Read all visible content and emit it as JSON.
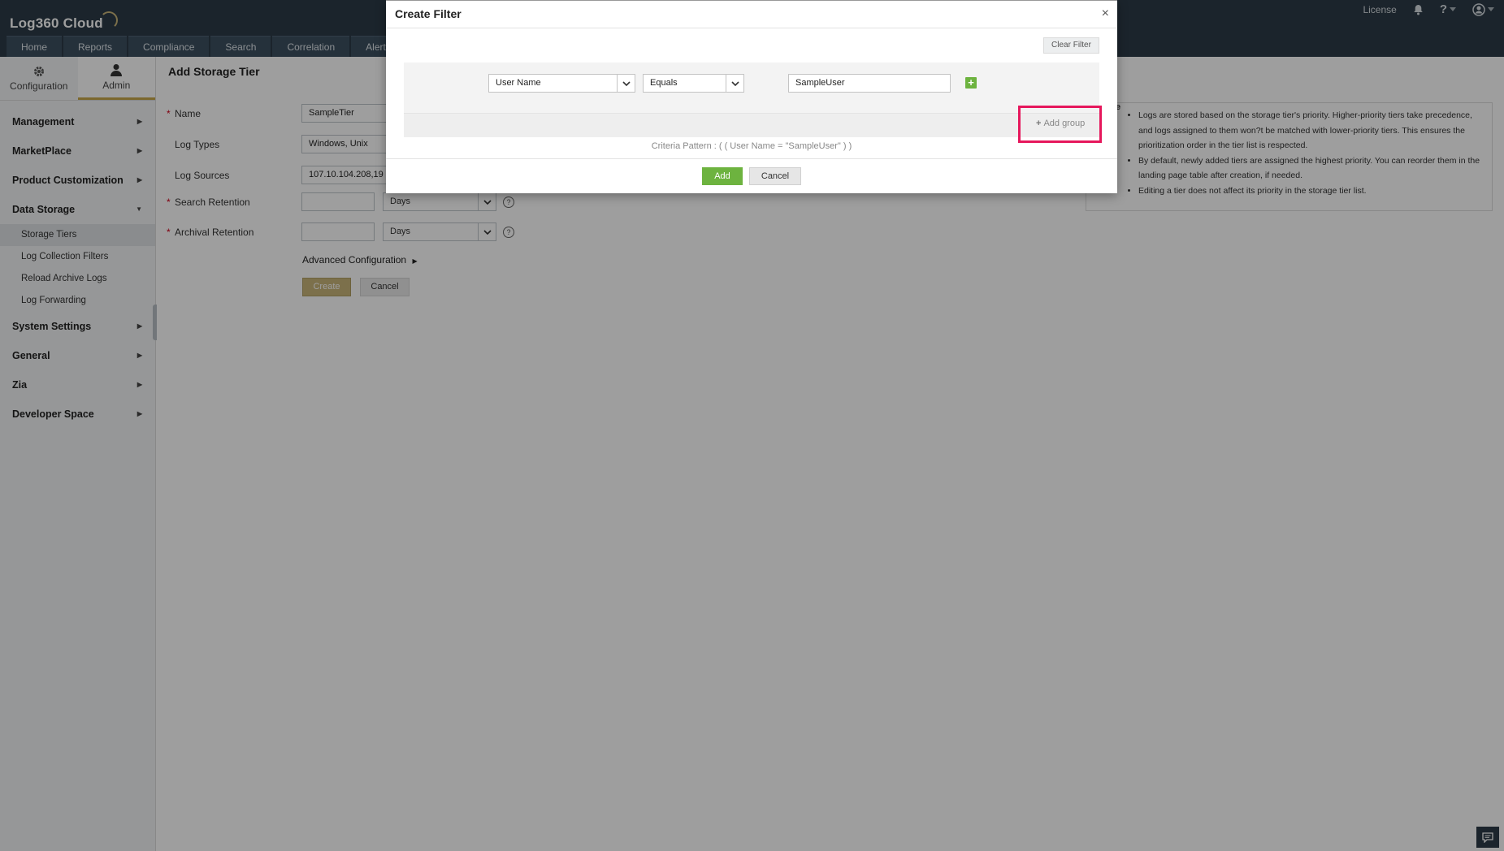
{
  "header": {
    "logo_text": "Log360 Cloud",
    "license_label": "License",
    "help_label": "?",
    "nav_tabs": [
      "Home",
      "Reports",
      "Compliance",
      "Search",
      "Correlation",
      "Alerts"
    ]
  },
  "sidebar": {
    "tabs": [
      {
        "label": "Configuration",
        "icon": "gear-icon"
      },
      {
        "label": "Admin",
        "icon": "user-icon"
      }
    ],
    "menu": [
      {
        "label": "Management"
      },
      {
        "label": "MarketPlace"
      },
      {
        "label": "Product Customization"
      },
      {
        "label": "Data Storage"
      },
      {
        "label": "System Settings"
      },
      {
        "label": "General"
      },
      {
        "label": "Zia"
      },
      {
        "label": "Developer Space"
      }
    ],
    "data_storage_sub": [
      "Storage Tiers",
      "Log Collection Filters",
      "Reload Archive Logs",
      "Log Forwarding"
    ]
  },
  "form": {
    "title": "Add Storage Tier",
    "name_label": "Name",
    "name_value": "SampleTier",
    "log_types_label": "Log Types",
    "log_types_value": "Windows, Unix",
    "log_sources_label": "Log Sources",
    "log_sources_value": "107.10.104.208,19",
    "search_retention_label": "Search Retention",
    "search_retention_unit": "Days",
    "archival_retention_label": "Archival Retention",
    "archival_retention_unit": "Days",
    "advanced_label": "Advanced Configuration",
    "create_label": "Create",
    "cancel_label": "Cancel",
    "required_mark": "*"
  },
  "notes": {
    "label": "e",
    "items": [
      "Logs are stored based on the storage tier's priority. Higher-priority tiers take precedence, and logs assigned to them won?t be matched with lower-priority tiers. This ensures the prioritization order in the tier list is respected.",
      "By default, newly added tiers are assigned the highest priority. You can reorder them in the landing page table after creation, if needed.",
      "Editing a tier does not affect its priority in the storage tier list."
    ]
  },
  "modal": {
    "title": "Create Filter",
    "close": "×",
    "clear_filter": "Clear Filter",
    "field": "User Name",
    "operator": "Equals",
    "value": "SampleUser",
    "add_criteria": "+",
    "add_group": "Add group",
    "add_group_icon": "+",
    "criteria_pattern": "Criteria Pattern : ( ( User Name = \"SampleUser\" ) )",
    "add_label": "Add",
    "cancel_label": "Cancel"
  },
  "colors": {
    "header_bg": "#2d3b47",
    "accent_gold": "#c9a94b",
    "add_green": "#6db33f",
    "highlight_pink": "#e6175c"
  }
}
